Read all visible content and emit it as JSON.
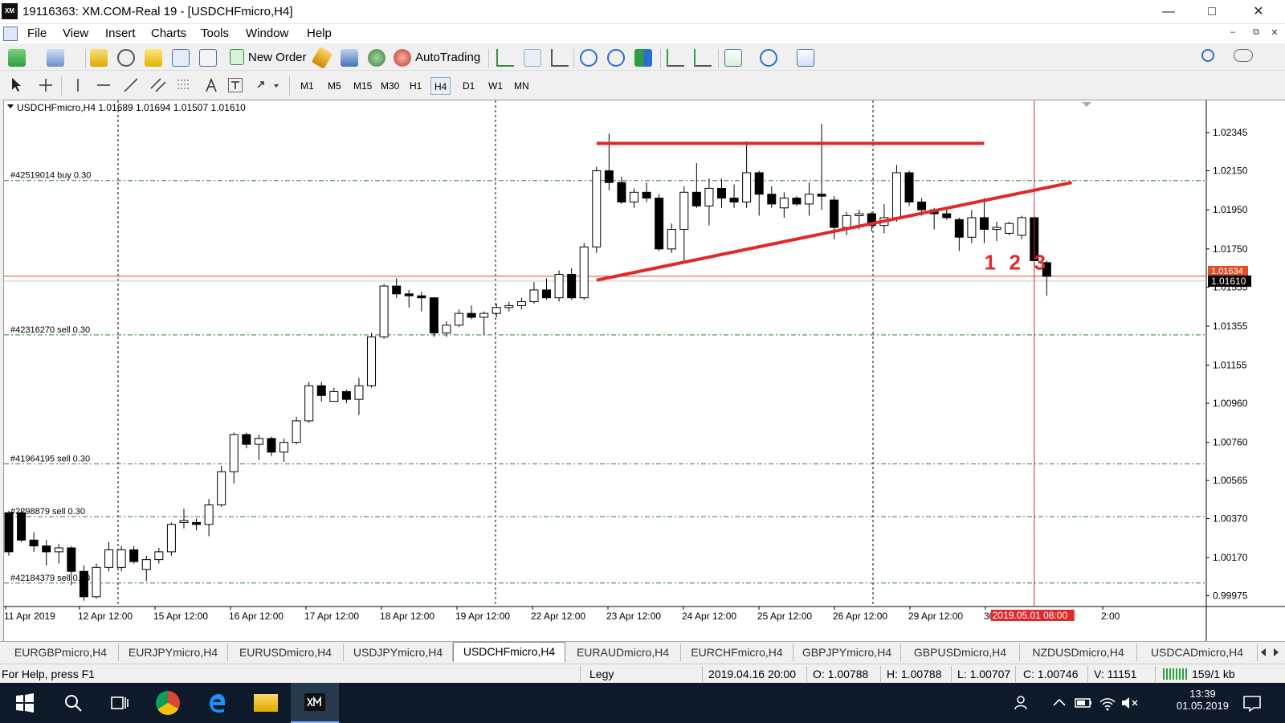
{
  "window": {
    "title": "19116363: XM.COM-Real 19 - [USDCHFmicro,H4]",
    "logo": "XM",
    "controls": {
      "minimize": "—",
      "maximize": "□",
      "close": "✕"
    }
  },
  "menu": {
    "items": [
      "File",
      "View",
      "Insert",
      "Charts",
      "Tools",
      "Window",
      "Help"
    ],
    "mdi_controls": [
      "–",
      "⧉",
      "✕"
    ]
  },
  "toolbar": {
    "new_order_label": "New Order",
    "autotrading_label": "AutoTrading",
    "icons": [
      "new-chart-icon",
      "profiles-icon",
      "market-watch-icon",
      "navigator-icon",
      "favorites-icon",
      "terminal-icon",
      "tester-icon",
      "new-order-icon",
      "meta-editor-icon",
      "options-icon",
      "signals-icon",
      "autotrading-icon",
      "bar-chart-icon",
      "candlestick-icon",
      "line-chart-icon",
      "zoom-in-icon",
      "zoom-out-icon",
      "tile-windows-icon",
      "auto-scroll-icon",
      "chart-shift-icon",
      "indicators-icon",
      "periods-icon",
      "templates-icon",
      "search-icon",
      "chat-icon"
    ]
  },
  "timeframes": [
    "M1",
    "M5",
    "M15",
    "M30",
    "H1",
    "H4",
    "D1",
    "W1",
    "MN"
  ],
  "active_timeframe": "H4",
  "chart": {
    "header": "USDCHFmicro,H4  1.01689 1.01694 1.01507 1.01610",
    "current_price_label": "1.01610",
    "hidden_price_label": "1.01634",
    "crosshair_time_label": "2019.05.01 08:00",
    "annotation_numbers": [
      "1",
      "2",
      "3"
    ],
    "colors": {
      "price_line": "#e04e2a",
      "order_line": "#2e7d32",
      "trend_line": "#e02a2a",
      "crosshair": "#c0392b"
    }
  },
  "chart_data": {
    "type": "candlestick",
    "symbol": "USDCHFmicro",
    "timeframe": "H4",
    "ohlc_header": {
      "open": 1.01689,
      "high": 1.01694,
      "low": 1.01507,
      "close": 1.0161
    },
    "y_ticks": [
      "1.02345",
      "1.02150",
      "1.01950",
      "1.01750",
      "1.01555",
      "1.01355",
      "1.01155",
      "1.00960",
      "1.00760",
      "1.00565",
      "1.00370",
      "1.00170",
      "0.99975"
    ],
    "y_range": [
      0.9992,
      1.0251
    ],
    "x_ticks": [
      "11 Apr 2019",
      "12 Apr 12:00",
      "15 Apr 12:00",
      "16 Apr 12:00",
      "17 Apr 12:00",
      "18 Apr 12:00",
      "19 Apr 12:00",
      "22 Apr 12:00",
      "23 Apr 12:00",
      "24 Apr 12:00",
      "25 Apr 12:00",
      "26 Apr 12:00",
      "29 Apr 12:00",
      "30 A",
      "2:00"
    ],
    "order_lines": [
      {
        "label": "#42519014 buy 0.30",
        "price": 1.021
      },
      {
        "label": "#42316270 sell 0.30",
        "price": 1.0131
      },
      {
        "label": "#41964195 sell 0.30",
        "price": 1.0065
      },
      {
        "label": "#2298879 sell 0.30",
        "price": 1.0038
      },
      {
        "label": "#42184379 sell 0.30",
        "price": 1.0004
      }
    ],
    "current_price": 1.0161,
    "candles": [
      [
        1.004,
        1.0041,
        1.0018,
        1.002
      ],
      [
        1.004,
        1.0042,
        1.0025,
        1.0026
      ],
      [
        1.0026,
        1.003,
        1.002,
        1.0023
      ],
      [
        1.0023,
        1.0026,
        1.0013,
        1.002
      ],
      [
        1.002,
        1.0024,
        1.0014,
        1.0022
      ],
      [
        1.0022,
        1.0023,
        1.0003,
        1.001
      ],
      [
        1.001,
        1.0013,
        0.9995,
        0.9997
      ],
      [
        0.9997,
        1.0014,
        0.9996,
        1.0012
      ],
      [
        1.0012,
        1.0025,
        1.001,
        1.0021
      ],
      [
        1.0012,
        1.0023,
        1.001,
        1.0021
      ],
      [
        1.0021,
        1.0023,
        1.0014,
        1.0015
      ],
      [
        1.0011,
        1.0018,
        1.0005,
        1.0016
      ],
      [
        1.0016,
        1.0022,
        1.0014,
        1.002
      ],
      [
        1.002,
        1.0035,
        1.0018,
        1.0034
      ],
      [
        1.0035,
        1.0042,
        1.0032,
        1.0036
      ],
      [
        1.0035,
        1.0037,
        1.0031,
        1.0034
      ],
      [
        1.0034,
        1.0047,
        1.0028,
        1.0044
      ],
      [
        1.0044,
        1.0064,
        1.0043,
        1.0061
      ],
      [
        1.0061,
        1.0081,
        1.0055,
        1.008
      ],
      [
        1.008,
        1.0081,
        1.0073,
        1.0075
      ],
      [
        1.0075,
        1.008,
        1.0067,
        1.0078
      ],
      [
        1.0078,
        1.0079,
        1.0069,
        1.0071
      ],
      [
        1.0071,
        1.0078,
        1.0066,
        1.0076
      ],
      [
        1.0076,
        1.0089,
        1.0075,
        1.0087
      ],
      [
        1.0087,
        1.0107,
        1.0086,
        1.0105
      ],
      [
        1.0105,
        1.0107,
        1.0097,
        1.01
      ],
      [
        1.0097,
        1.0104,
        1.0097,
        1.0102
      ],
      [
        1.0102,
        1.0103,
        1.0096,
        1.0098
      ],
      [
        1.0098,
        1.0109,
        1.009,
        1.0105
      ],
      [
        1.0105,
        1.0132,
        1.0104,
        1.013
      ],
      [
        1.013,
        1.0157,
        1.0129,
        1.0156
      ],
      [
        1.0156,
        1.016,
        1.015,
        1.0152
      ],
      [
        1.0152,
        1.0154,
        1.0145,
        1.0151
      ],
      [
        1.0151,
        1.0153,
        1.0143,
        1.015
      ],
      [
        1.015,
        1.015,
        1.013,
        1.0132
      ],
      [
        1.0132,
        1.0138,
        1.013,
        1.0136
      ],
      [
        1.0136,
        1.0144,
        1.0135,
        1.0142
      ],
      [
        1.0142,
        1.0146,
        1.0139,
        1.014
      ],
      [
        1.014,
        1.0143,
        1.0131,
        1.0142
      ],
      [
        1.0142,
        1.0147,
        1.014,
        1.0145
      ],
      [
        1.0145,
        1.0148,
        1.0143,
        1.0146
      ],
      [
        1.0146,
        1.015,
        1.0144,
        1.0148
      ],
      [
        1.0148,
        1.0158,
        1.0147,
        1.0154
      ],
      [
        1.0154,
        1.016,
        1.0149,
        1.015
      ],
      [
        1.015,
        1.0164,
        1.0148,
        1.0162
      ],
      [
        1.0162,
        1.0165,
        1.0149,
        1.015
      ],
      [
        1.015,
        1.0178,
        1.0149,
        1.0176
      ],
      [
        1.0176,
        1.0217,
        1.0173,
        1.0215
      ],
      [
        1.0215,
        1.0234,
        1.0205,
        1.0209
      ],
      [
        1.0209,
        1.0212,
        1.0198,
        1.0199
      ],
      [
        1.0199,
        1.0206,
        1.0196,
        1.0204
      ],
      [
        1.0204,
        1.0209,
        1.0199,
        1.0201
      ],
      [
        1.0201,
        1.0203,
        1.0174,
        1.0175
      ],
      [
        1.0175,
        1.0188,
        1.0173,
        1.0185
      ],
      [
        1.0185,
        1.0207,
        1.0168,
        1.0204
      ],
      [
        1.0204,
        1.0219,
        1.0196,
        1.0197
      ],
      [
        1.0197,
        1.0211,
        1.0187,
        1.0206
      ],
      [
        1.0206,
        1.0211,
        1.0196,
        1.0201
      ],
      [
        1.0201,
        1.0208,
        1.0196,
        1.0199
      ],
      [
        1.0199,
        1.023,
        1.0196,
        1.0214
      ],
      [
        1.0214,
        1.0215,
        1.0192,
        1.0203
      ],
      [
        1.0203,
        1.0207,
        1.0196,
        1.0198
      ],
      [
        1.0196,
        1.0204,
        1.0191,
        1.0201
      ],
      [
        1.0201,
        1.0202,
        1.0197,
        1.0198
      ],
      [
        1.0198,
        1.0209,
        1.0192,
        1.0203
      ],
      [
        1.0203,
        1.0239,
        1.0195,
        1.0202
      ],
      [
        1.02,
        1.0202,
        1.018,
        1.0186
      ],
      [
        1.0186,
        1.0194,
        1.0182,
        1.0192
      ],
      [
        1.0192,
        1.0195,
        1.0185,
        1.0193
      ],
      [
        1.0193,
        1.0194,
        1.0184,
        1.0187
      ],
      [
        1.0187,
        1.0198,
        1.0183,
        1.0191
      ],
      [
        1.0191,
        1.0218,
        1.0189,
        1.0214
      ],
      [
        1.0214,
        1.0215,
        1.0197,
        1.0199
      ],
      [
        1.0199,
        1.0201,
        1.0192,
        1.0195
      ],
      [
        1.0195,
        1.0196,
        1.0185,
        1.0193
      ],
      [
        1.0193,
        1.0196,
        1.019,
        1.0191
      ],
      [
        1.019,
        1.0191,
        1.0174,
        1.0181
      ],
      [
        1.0181,
        1.0195,
        1.0178,
        1.0191
      ],
      [
        1.0191,
        1.0201,
        1.0178,
        1.0185
      ],
      [
        1.0185,
        1.0189,
        1.0179,
        1.0186
      ],
      [
        1.0183,
        1.0189,
        1.0182,
        1.0188
      ],
      [
        1.0182,
        1.0192,
        1.018,
        1.0191
      ],
      [
        1.0191,
        1.0192,
        1.0166,
        1.0169
      ],
      [
        1.0168,
        1.0169,
        1.0151,
        1.0161
      ]
    ],
    "crosshair_candle_index": 82,
    "resistance_line": {
      "from_index": 47,
      "to_index": 78,
      "price": 1.0229
    },
    "trend_line": {
      "from": {
        "index": 47,
        "price": 1.0159
      },
      "to": {
        "index": 85,
        "price": 1.0209
      }
    }
  },
  "tabs": [
    "EURGBPmicro,H4",
    "EURJPYmicro,H4",
    "EURUSDmicro,H4",
    "USDJPYmicro,H4",
    "USDCHFmicro,H4",
    "EURAUDmicro,H4",
    "EURCHFmicro,H4",
    "GBPJPYmicro,H4",
    "GBPUSDmicro,H4",
    "NZDUSDmicro,H4",
    "USDCADmicro,H4"
  ],
  "active_tab": "USDCHFmicro,H4",
  "status": {
    "help": "For Help, press F1",
    "profile": "Legy",
    "datetime": "2019.04.16 20:00",
    "open": "O: 1.00788",
    "high": "H: 1.00788",
    "low": "L: 1.00707",
    "close": "C: 1.00746",
    "volume": "V: 11151",
    "traffic": "159/1 kb"
  },
  "taskbar": {
    "time": "13:39",
    "date": "01.05.2019"
  }
}
